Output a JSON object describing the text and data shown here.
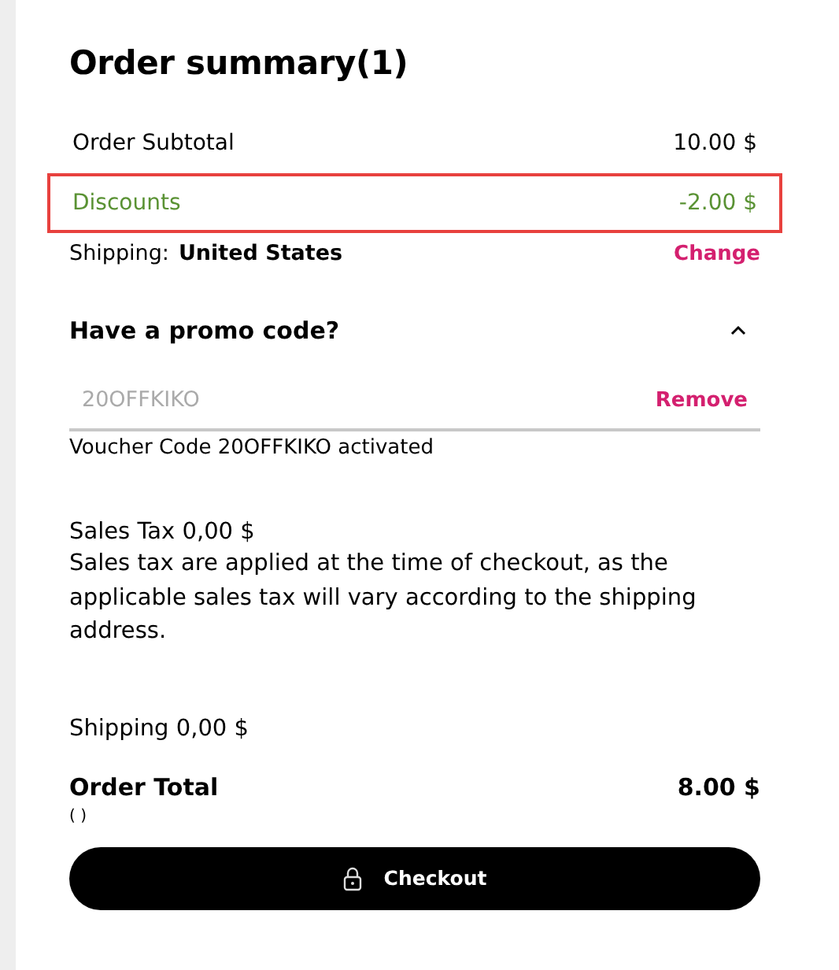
{
  "title": "Order summary(1)",
  "rows": [
    {
      "label": "Order Subtotal",
      "value": "10.00 $",
      "kind": "plain",
      "highlighted": false
    },
    {
      "label": "Discounts",
      "value": "-2.00 $",
      "kind": "discount",
      "highlighted": true
    }
  ],
  "shipping": {
    "label": "Shipping:",
    "country": "United States",
    "action": "Change"
  },
  "promo": {
    "heading": "Have a promo code?",
    "expanded": true,
    "placeholder": "20OFFKIKO",
    "action": "Remove",
    "message": "Voucher Code 20OFFKIKO activated"
  },
  "sales_tax": {
    "amount": "Sales Tax 0,00 $",
    "note": "Sales tax are applied at the time of checkout, as the applicable sales tax will vary according to the shipping address."
  },
  "shipping_cost": "Shipping 0,00 $",
  "total": {
    "label": "Order Total",
    "value": "8.00 $",
    "note": "( )"
  },
  "checkout": "Checkout"
}
